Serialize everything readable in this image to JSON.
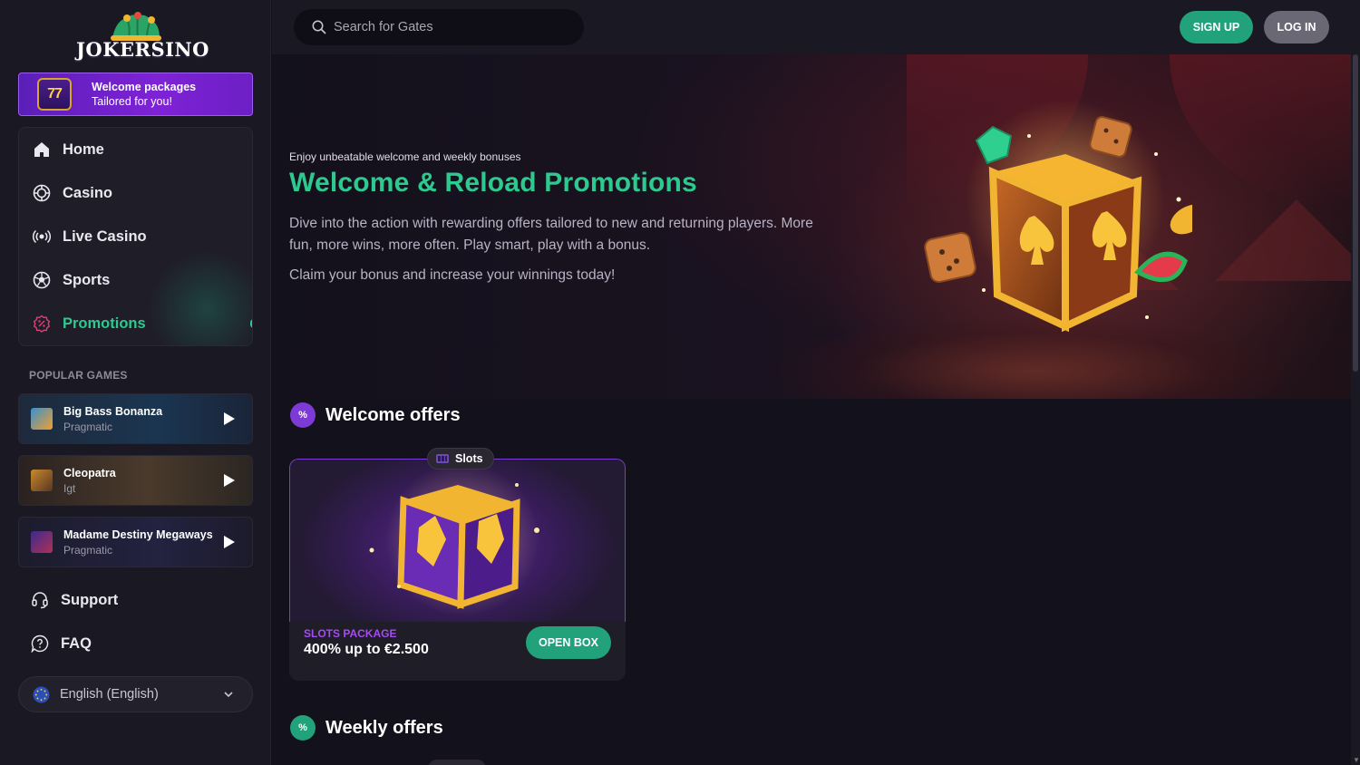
{
  "brand": {
    "name": "JOKERSINO"
  },
  "welcome_banner": {
    "badge": "77",
    "line1": "Welcome packages",
    "line2": "Tailored for you!"
  },
  "nav": [
    {
      "label": "Home",
      "icon": "home-icon",
      "active": false
    },
    {
      "label": "Casino",
      "icon": "casino-chip-icon",
      "active": false
    },
    {
      "label": "Live Casino",
      "icon": "live-broadcast-icon",
      "active": false
    },
    {
      "label": "Sports",
      "icon": "soccer-ball-icon",
      "active": false
    },
    {
      "label": "Promotions",
      "icon": "promotion-percent-icon",
      "active": true
    }
  ],
  "popular": {
    "heading": "POPULAR GAMES",
    "games": [
      {
        "name": "Big Bass Bonanza",
        "provider": "Pragmatic"
      },
      {
        "name": "Cleopatra",
        "provider": "Igt"
      },
      {
        "name": "Madame Destiny Megaways",
        "provider": "Pragmatic"
      }
    ]
  },
  "links": {
    "support": "Support",
    "faq": "FAQ"
  },
  "language": {
    "selected": "English (English)"
  },
  "topbar": {
    "search_placeholder": "Search for Gates",
    "signup": "SIGN UP",
    "login": "LOG IN"
  },
  "hero": {
    "subtitle": "Enjoy unbeatable welcome and weekly bonuses",
    "title": "Welcome & Reload Promotions",
    "paragraph1": "Dive into the action with rewarding offers tailored to new and returning players. More fun, more wins, more often. Play smart, play with a bonus.",
    "paragraph2": "Claim your bonus and increase your winnings today!"
  },
  "welcome_offers": {
    "heading": "Welcome offers",
    "offer": {
      "tag": "Slots",
      "type": "SLOTS PACKAGE",
      "value": "400% up to €2.500",
      "button": "OPEN BOX"
    }
  },
  "weekly_offers": {
    "heading": "Weekly offers"
  },
  "colors": {
    "accent_green": "#2ec98f",
    "button_green": "#22a27a",
    "purple": "#7e22d6",
    "background": "#13111c",
    "sidebar": "#1a1822"
  }
}
